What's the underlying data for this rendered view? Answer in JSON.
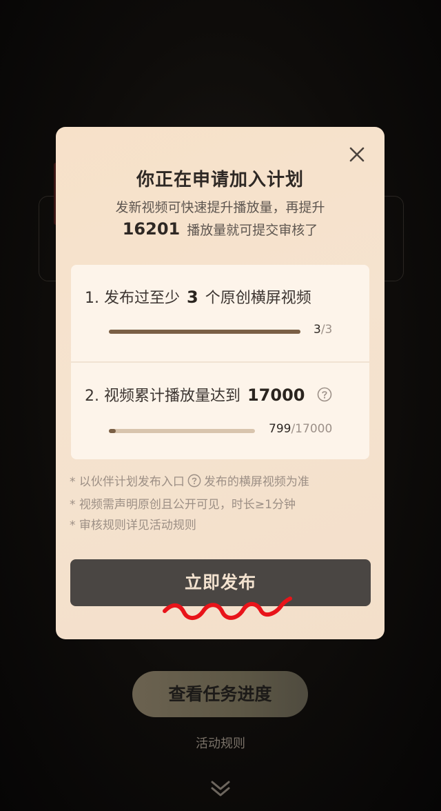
{
  "modal": {
    "title": "你正在申请加入计划",
    "subtitle_line1": "发新视频可快速提升播放量，再提升",
    "subtitle_number": "16201",
    "subtitle_line2_rest": "播放量就可提交审核了",
    "tasks": [
      {
        "prefix": "1. 发布过至少",
        "highlight": "3",
        "suffix": "个原创横屏视频",
        "current": "3",
        "total": "/3",
        "progress": 1.0
      },
      {
        "prefix": "2. 视频累计播放量达到",
        "highlight": "17000",
        "suffix": "",
        "current": "799",
        "total": "/17000",
        "progress": 0.047
      }
    ],
    "notes": [
      {
        "before": "* 以伙伴计划发布入口",
        "after": "发布的横屏视频为准"
      },
      {
        "text": "* 视频需声明原创且公开可见，时长≥1分钟"
      },
      {
        "text": "* 审核规则详见活动规则"
      }
    ],
    "publish_label": "立即发布"
  },
  "footer": {
    "progress_button": "查看任务进度",
    "rules_link": "活动规则"
  },
  "icons": {
    "close": "close-icon",
    "help": "question-circle-icon",
    "chevron": "double-chevron-down-icon"
  },
  "colors": {
    "modal_bg": "#f6e2cc",
    "button_dark": "#4a4643",
    "progress_fill": "#7a5f45",
    "squiggle": "#e8141a"
  }
}
